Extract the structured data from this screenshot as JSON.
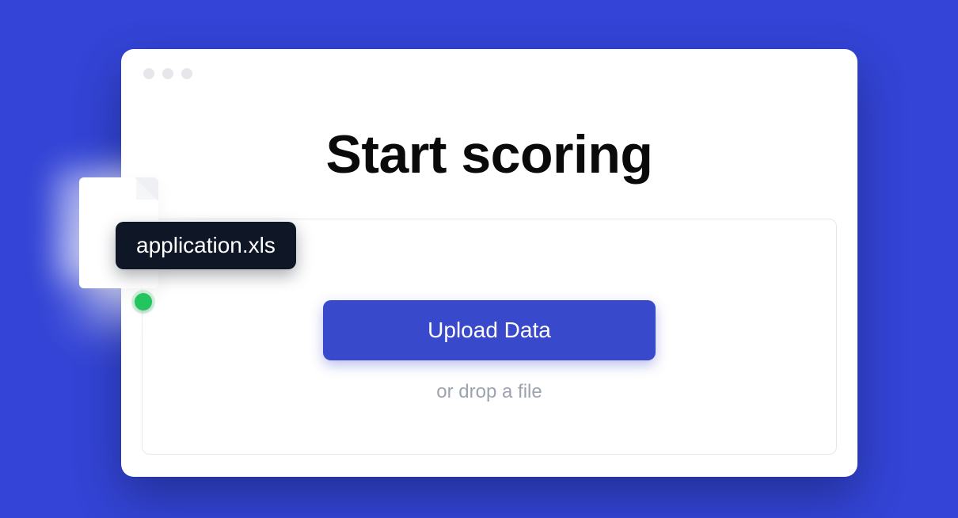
{
  "page": {
    "title": "Start scoring"
  },
  "upload": {
    "button_label": "Upload Data",
    "hint": "or drop a file"
  },
  "file": {
    "name": "application.xls"
  },
  "colors": {
    "background": "#3344d6",
    "accent": "#3949cc",
    "status_ok": "#22c55e"
  }
}
